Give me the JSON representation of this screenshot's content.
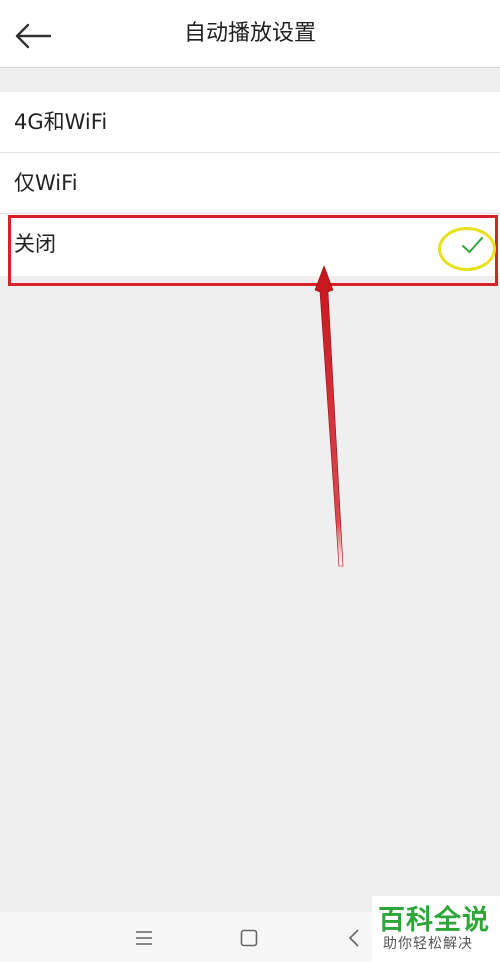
{
  "header": {
    "title": "自动播放设置"
  },
  "options": [
    {
      "label": "4G和WiFi",
      "selected": false
    },
    {
      "label": "仅WiFi",
      "selected": false
    },
    {
      "label": "关闭",
      "selected": true
    }
  ],
  "annotation_colors": {
    "highlight_box": "#d6232a",
    "check_circle": "#e6e21b",
    "check_mark": "#2fa63a"
  },
  "watermark": {
    "brand": "百科全说",
    "slogan": "助你轻松解决"
  },
  "navbar": {
    "icons": [
      "menu-icon",
      "home-square-icon",
      "back-chevron-icon"
    ]
  }
}
